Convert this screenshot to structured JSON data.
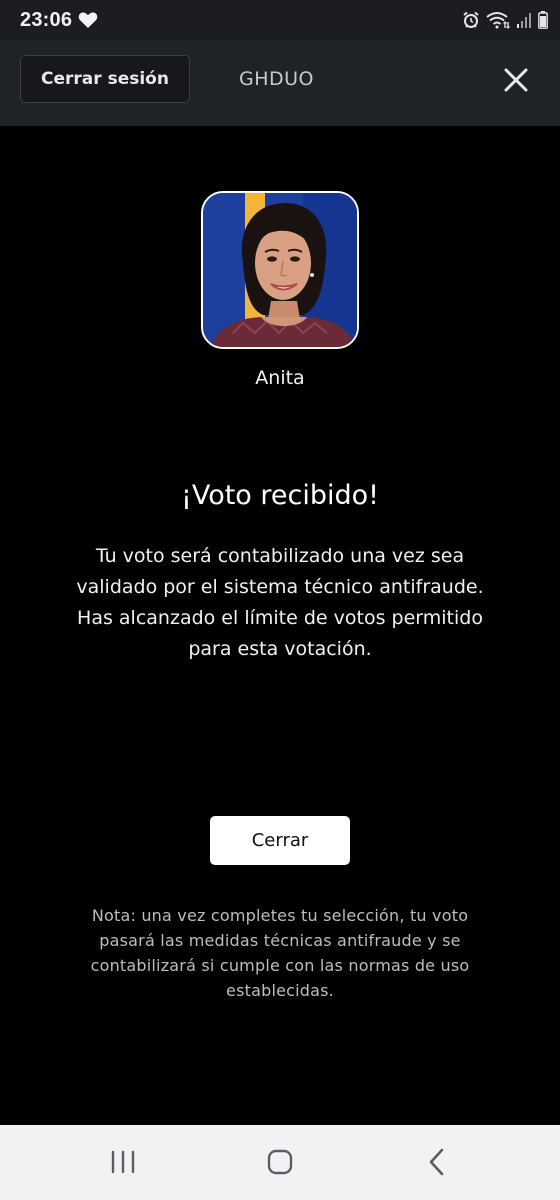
{
  "status_bar": {
    "time": "23:06",
    "left_icons": [
      "heart-icon"
    ],
    "right_icons": [
      "alarm-icon",
      "wifi-icon",
      "signal-icon",
      "battery-icon"
    ]
  },
  "header": {
    "logout_label": "Cerrar sesión",
    "title": "GHDUO",
    "close_icon": "close-icon"
  },
  "candidate": {
    "name": "Anita"
  },
  "confirmation": {
    "title": "¡Voto recibido!",
    "message_lines": [
      "Tu voto será contabilizado una vez sea",
      "validado por el sistema técnico antifraude.",
      "Has alcanzado el límite de votos permitido",
      "para esta votación."
    ],
    "close_label": "Cerrar"
  },
  "note_lines": [
    "Nota: una vez completes tu selección, tu voto",
    "pasará las medidas técnicas antifraude y se",
    "contabilizará si cumple con las normas de uso",
    "establecidas."
  ],
  "nav_bar": {
    "icons": [
      "recent-apps-icon",
      "home-icon",
      "back-icon"
    ]
  },
  "colors": {
    "background": "#000000",
    "header_bg": "#1f2226",
    "status_bg": "#1b1d20",
    "nav_bg": "#f1f2f4",
    "button_bg": "#ffffff",
    "note_text": "#bdbdbd",
    "avatar_blue": "#1d3f9e",
    "avatar_yellow": "#f2b43a"
  }
}
